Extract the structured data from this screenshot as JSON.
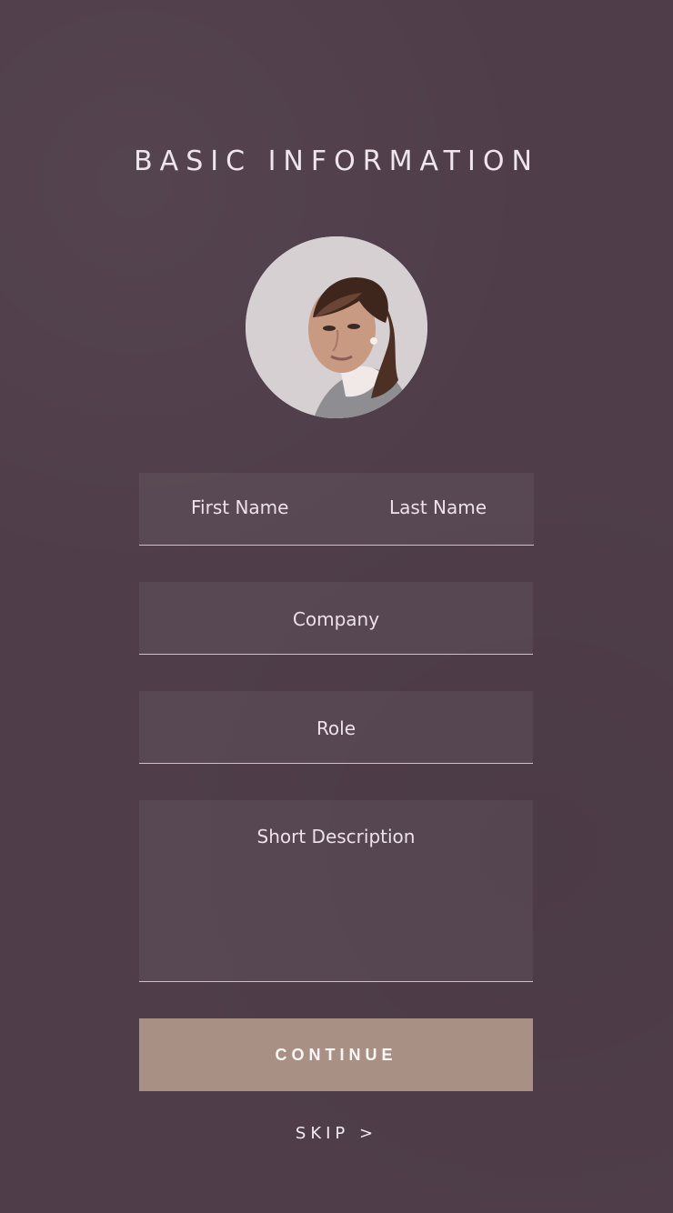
{
  "screen": {
    "title": "BASIC INFORMATION"
  },
  "profile": {
    "avatar_icon": "user-photo"
  },
  "form": {
    "first_name_placeholder": "First Name",
    "last_name_placeholder": "Last Name",
    "company_placeholder": "Company",
    "role_placeholder": "Role",
    "description_placeholder": "Short Description"
  },
  "actions": {
    "continue_label": "CONTINUE",
    "skip_label": "SKIP >"
  },
  "colors": {
    "background": "#4f3e4a",
    "field_fill": "#584753",
    "field_line": "#d5c0b4",
    "button": "#a89085",
    "text": "#ede2e9"
  }
}
